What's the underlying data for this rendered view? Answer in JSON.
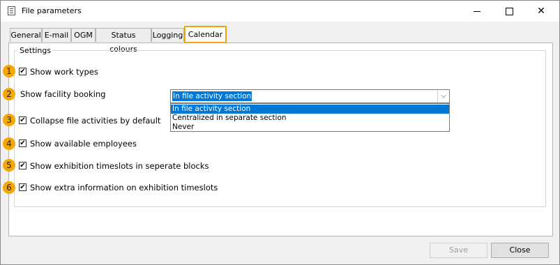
{
  "window": {
    "title": "File parameters",
    "icon": "document-icon",
    "controls": {
      "minimize": "minimize-icon",
      "maximize": "maximize-icon",
      "close": "close-icon"
    }
  },
  "tabs": [
    {
      "label": "General",
      "active": false
    },
    {
      "label": "E-mail",
      "active": false
    },
    {
      "label": "OGM",
      "active": false
    },
    {
      "label": "Status colours",
      "active": false
    },
    {
      "label": "Logging",
      "active": false
    },
    {
      "label": "Calendar",
      "active": true
    }
  ],
  "settings": {
    "legend": "Settings",
    "items": [
      {
        "badge": "1",
        "label": "Show work types",
        "type": "checkbox",
        "checked": true
      },
      {
        "badge": "2",
        "label": "Show facility booking",
        "type": "select"
      },
      {
        "badge": "3",
        "label": "Collapse file activities by default",
        "type": "checkbox",
        "checked": true
      },
      {
        "badge": "4",
        "label": "Show available employees",
        "type": "checkbox",
        "checked": true
      },
      {
        "badge": "5",
        "label": "Show exhibition timeslots in seperate blocks",
        "type": "checkbox",
        "checked": true
      },
      {
        "badge": "6",
        "label": "Show extra information on exhibition timeslots",
        "type": "checkbox",
        "checked": true
      }
    ],
    "facility_select": {
      "value": "In file activity section",
      "options": [
        "In file activity section",
        "Centralized in separate section",
        "Never"
      ],
      "open": true
    }
  },
  "footer": {
    "save_label": "Save",
    "save_enabled": false,
    "close_label": "Close"
  },
  "colors": {
    "highlight": "#f0a30a",
    "badge": "#f5a700",
    "selection": "#0078d7"
  }
}
